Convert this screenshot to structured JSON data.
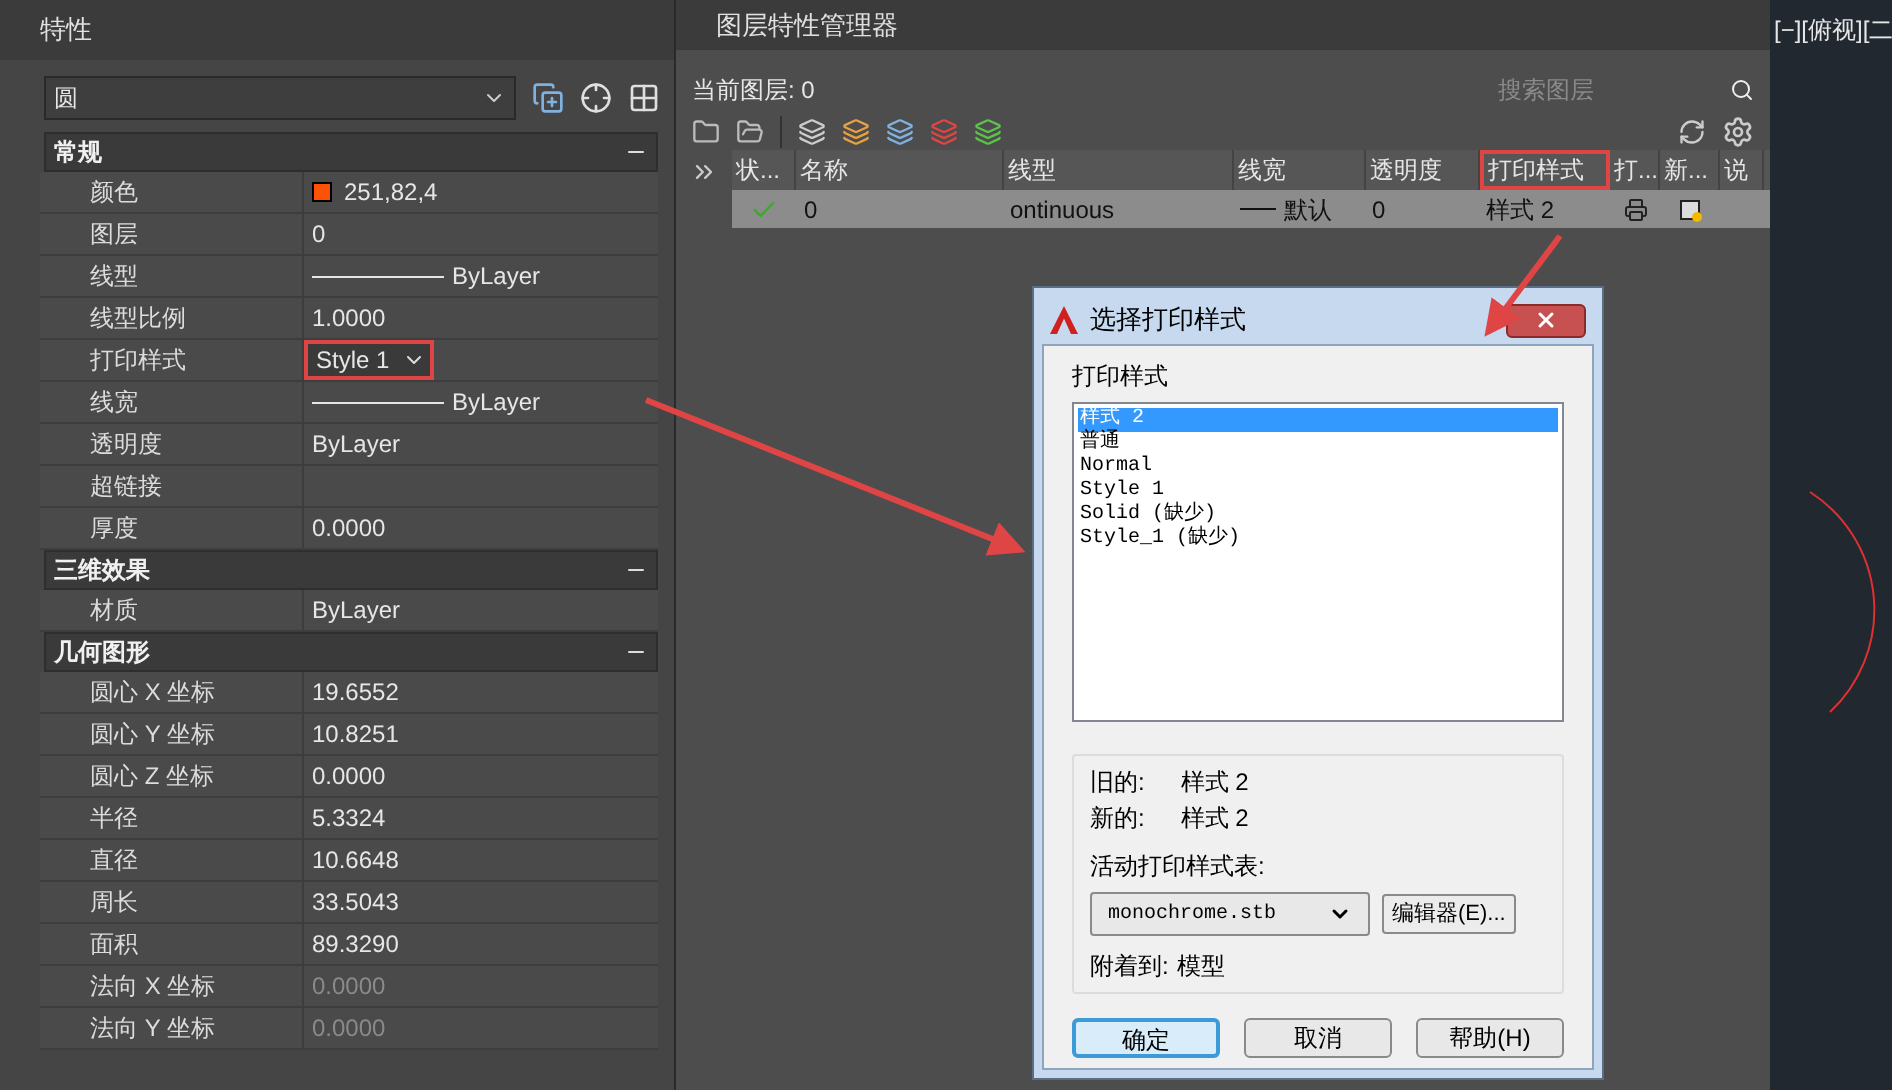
{
  "properties": {
    "title": "特性",
    "object_type": "圆",
    "sections": [
      {
        "title": "常规",
        "expanded": true,
        "rows": [
          {
            "label": "颜色",
            "value": "251,82,4",
            "kind": "color",
            "color": "#fb5204"
          },
          {
            "label": "图层",
            "value": "0",
            "kind": "text"
          },
          {
            "label": "线型",
            "value": "ByLayer",
            "kind": "line"
          },
          {
            "label": "线型比例",
            "value": "1.0000",
            "kind": "text"
          },
          {
            "label": "打印样式",
            "value": "Style 1",
            "kind": "dropdown",
            "annotated": true
          },
          {
            "label": "线宽",
            "value": "ByLayer",
            "kind": "line"
          },
          {
            "label": "透明度",
            "value": "ByLayer",
            "kind": "text"
          },
          {
            "label": "超链接",
            "kind": "text"
          },
          {
            "label": "厚度",
            "value": "0.0000",
            "kind": "text"
          }
        ]
      },
      {
        "title": "三维效果",
        "expanded": true,
        "rows": [
          {
            "label": "材质",
            "value": "ByLayer",
            "kind": "text"
          }
        ]
      },
      {
        "title": "几何图形",
        "expanded": true,
        "rows": [
          {
            "label": "圆心 X 坐标",
            "value": "19.6552",
            "kind": "text"
          },
          {
            "label": "圆心 Y 坐标",
            "value": "10.8251",
            "kind": "text"
          },
          {
            "label": "圆心 Z 坐标",
            "value": "0.0000",
            "kind": "text"
          },
          {
            "label": "半径",
            "value": "5.3324",
            "kind": "text"
          },
          {
            "label": "直径",
            "value": "10.6648",
            "kind": "text"
          },
          {
            "label": "周长",
            "value": "33.5043",
            "kind": "text"
          },
          {
            "label": "面积",
            "value": "89.3290",
            "kind": "text"
          },
          {
            "label": "法向 X 坐标",
            "value": "0.0000",
            "kind": "text",
            "disabled": true
          },
          {
            "label": "法向 Y 坐标",
            "value": "0.0000",
            "kind": "text",
            "disabled": true
          }
        ]
      }
    ]
  },
  "layer_manager": {
    "title": "图层特性管理器",
    "current_layer": "当前图层: 0",
    "search": {
      "placeholder": "搜索图层"
    },
    "columns": [
      {
        "label": "状..."
      },
      {
        "label": "名称"
      },
      {
        "label": "线型"
      },
      {
        "label": "线宽"
      },
      {
        "label": "透明度"
      },
      {
        "label": "打印样式",
        "annotated": true
      },
      {
        "label": "打..."
      },
      {
        "label": "新..."
      },
      {
        "label": "说"
      }
    ],
    "rows": [
      {
        "current": true,
        "selected": true,
        "name": "0",
        "linetype": "ontinuous",
        "lineweight": "默认",
        "transparency": "0",
        "plot_style": "样式 2"
      }
    ]
  },
  "viewport": {
    "label": "[−][俯视][二"
  },
  "dialog": {
    "title": "选择打印样式",
    "list_label": "打印样式",
    "styles": [
      {
        "label": "样式 2",
        "selected": true
      },
      {
        "label": "普通",
        "selected": false
      },
      {
        "label": "Normal",
        "selected": false
      },
      {
        "label": "Style 1",
        "selected": false
      },
      {
        "label": "Solid (缺少)",
        "selected": false
      },
      {
        "label": "Style_1 (缺少)",
        "selected": false
      }
    ],
    "old_label": "旧的:",
    "old_value": "样式 2",
    "new_label": "新的:",
    "new_value": "样式 2",
    "table_label": "活动打印样式表:",
    "table_value": "monochrome.stb",
    "editor_button": "编辑器(E)...",
    "attached_label": "附着到:",
    "attached_value": "模型",
    "buttons": [
      {
        "label": "确定",
        "default": true
      },
      {
        "label": "取消",
        "default": false
      },
      {
        "label": "帮助(H)",
        "default": false
      }
    ]
  }
}
